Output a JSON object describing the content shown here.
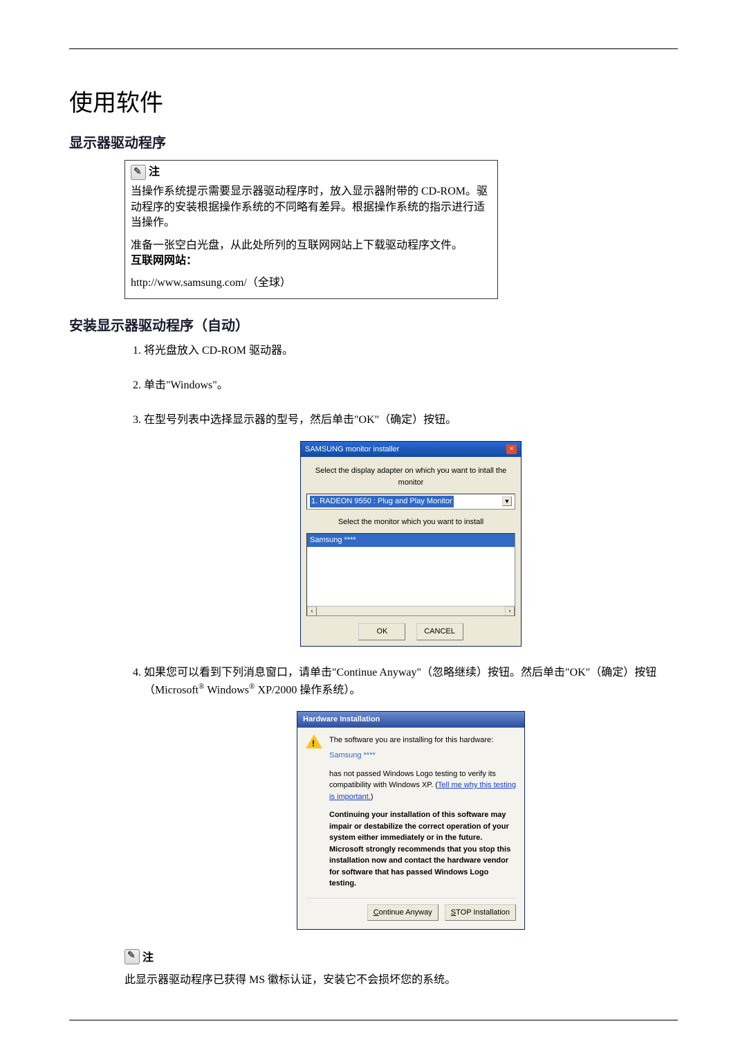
{
  "page": {
    "title": "使用软件",
    "section1": "显示器驱动程序",
    "section2": "安装显示器驱动程序（自动）"
  },
  "note": {
    "label": "注",
    "para1": "当操作系统提示需要显示器驱动程序时，放入显示器附带的 CD-ROM。驱动程序的安装根据操作系统的不同略有差异。根据操作系统的指示进行适当操作。",
    "para2a": "准备一张空白光盘，从此处所列的互联网网站上下载驱动程序文件。",
    "para2b": "互联网网站：",
    "para3": "http://www.samsung.com/（全球）"
  },
  "steps": {
    "s1": "将光盘放入 CD-ROM 驱动器。",
    "s2": "单击\"Windows\"。",
    "s3": "在型号列表中选择显示器的型号，然后单击\"OK\"（确定）按钮。",
    "s4a": "如果您可以看到下列消息窗口，请单击\"Continue Anyway\"（忽略继续）按钮。然后单击\"OK\"（确定）按钮（Microsoft",
    "s4b": " Windows",
    "s4c": " XP/2000 操作系统）。",
    "reg": "®"
  },
  "installer": {
    "title_pre": "SAMSUNG monitor installer",
    "line1": "Select the display adapter on which you want to intall the monitor",
    "adapter": "1. RADEON 9550 : Plug and Play Monitor",
    "line2": "Select the monitor which you want to install",
    "monitor": "Samsung ****",
    "ok": "OK",
    "cancel": "CANCEL"
  },
  "hw": {
    "title": "Hardware Installation",
    "l1": "The software you are installing for this hardware:",
    "prod": "Samsung ****",
    "l2a": "has not passed Windows Logo testing to verify its compatibility with Windows XP. (",
    "l2link": "Tell me why this testing is important.",
    "l2b": ")",
    "l3": "Continuing your installation of this software may impair or destabilize the correct operation of your system either immediately or in the future. Microsoft strongly recommends that you stop this installation now and contact the hardware vendor for software that has passed Windows Logo testing.",
    "btn_cont": "Continue Anyway",
    "btn_stop": "STOP Installation"
  },
  "footnote": {
    "label": "注",
    "text": "此显示器驱动程序已获得 MS 徽标认证，安装它不会损坏您的系统。"
  }
}
